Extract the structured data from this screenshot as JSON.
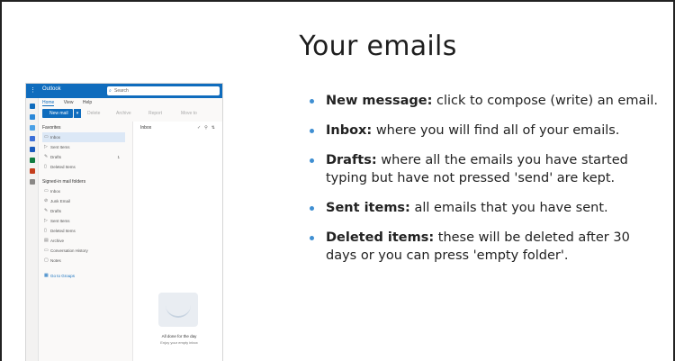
{
  "slide": {
    "title": "Your emails"
  },
  "outlook": {
    "brand": "Outlook",
    "search_placeholder": "Search",
    "ribbon_tabs": [
      "Home",
      "View",
      "Help"
    ],
    "new_mail_label": "New mail",
    "toolbar_items": [
      "Delete",
      "Archive",
      "Report",
      "Move to"
    ],
    "favorites_label": "Favorites",
    "favorites": [
      {
        "label": "Inbox",
        "selected": true
      },
      {
        "label": "Sent Items"
      },
      {
        "label": "Drafts",
        "count": "1"
      },
      {
        "label": "Deleted Items"
      }
    ],
    "account_label": "Signed-in mail folders",
    "folders": [
      {
        "label": "Inbox"
      },
      {
        "label": "Junk Email"
      },
      {
        "label": "Drafts"
      },
      {
        "label": "Sent Items"
      },
      {
        "label": "Deleted Items"
      },
      {
        "label": "Archive"
      },
      {
        "label": "Conversation History"
      },
      {
        "label": "Notes"
      }
    ],
    "go_to_groups": "Go to Groups",
    "list_header": "Inbox",
    "empty_title": "All done for the day",
    "empty_subtitle": "Enjoy your empty inbox"
  },
  "bullets": [
    {
      "term": "New message:",
      "text": " click to compose (write) an email."
    },
    {
      "term": "Inbox:",
      "text": " where you will find all of your emails."
    },
    {
      "term": "Drafts:",
      "text": " where all the emails you have started typing but have not pressed 'send' are kept."
    },
    {
      "term": "Sent items:",
      "text": " all emails that you have sent."
    },
    {
      "term": "Deleted items:",
      "text": " these will be deleted after 30 days or you can press 'empty folder'."
    }
  ],
  "colors": {
    "outlook_blue": "#0f6cbd",
    "bullet_blue": "#3f8fd2",
    "selected_row": "#dce8f6"
  }
}
